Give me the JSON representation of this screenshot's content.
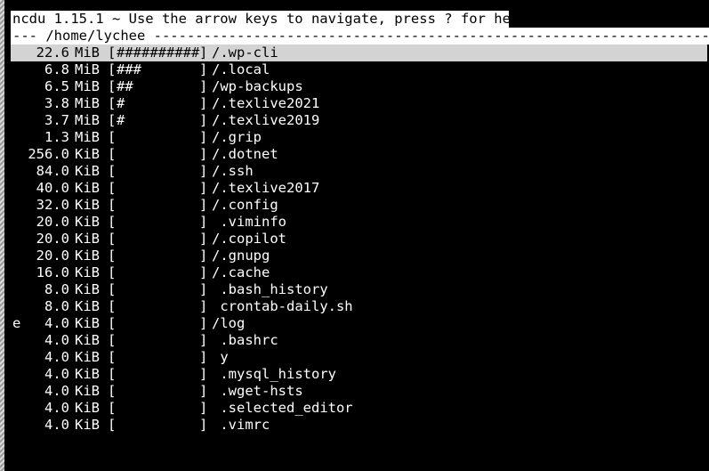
{
  "header": {
    "title_prefix": "ncdu 1.15.1 ~ Use the arrow keys to navigate, press ",
    "help_key": "?",
    "title_suffix": " for help"
  },
  "path_bar": {
    "text": "--- /home/lychee -------------------------------------------------------------------------------"
  },
  "entries": [
    {
      "flag": "",
      "size": "22.6",
      "unit": "MiB",
      "bar_open": "[",
      "bar": "##########",
      "bar_close": "]",
      "name": "/.wp-cli",
      "selected": true
    },
    {
      "flag": "",
      "size": "6.8",
      "unit": "MiB",
      "bar_open": "[",
      "bar": "###",
      "bar_close": "]",
      "name": "/.local"
    },
    {
      "flag": "",
      "size": "6.5",
      "unit": "MiB",
      "bar_open": "[",
      "bar": "##",
      "bar_close": "]",
      "name": "/wp-backups"
    },
    {
      "flag": "",
      "size": "3.8",
      "unit": "MiB",
      "bar_open": "[",
      "bar": "#",
      "bar_close": "]",
      "name": "/.texlive2021"
    },
    {
      "flag": "",
      "size": "3.7",
      "unit": "MiB",
      "bar_open": "[",
      "bar": "#",
      "bar_close": "]",
      "name": "/.texlive2019"
    },
    {
      "flag": "",
      "size": "1.3",
      "unit": "MiB",
      "bar_open": "[",
      "bar": "",
      "bar_close": "]",
      "name": "/.grip"
    },
    {
      "flag": "",
      "size": "256.0",
      "unit": "KiB",
      "bar_open": "[",
      "bar": "",
      "bar_close": "]",
      "name": "/.dotnet"
    },
    {
      "flag": "",
      "size": "84.0",
      "unit": "KiB",
      "bar_open": "[",
      "bar": "",
      "bar_close": "]",
      "name": "/.ssh"
    },
    {
      "flag": "",
      "size": "40.0",
      "unit": "KiB",
      "bar_open": "[",
      "bar": "",
      "bar_close": "]",
      "name": "/.texlive2017"
    },
    {
      "flag": "",
      "size": "32.0",
      "unit": "KiB",
      "bar_open": "[",
      "bar": "",
      "bar_close": "]",
      "name": "/.config"
    },
    {
      "flag": "",
      "size": "20.0",
      "unit": "KiB",
      "bar_open": "[",
      "bar": "",
      "bar_close": "]",
      "name": " .viminfo"
    },
    {
      "flag": "",
      "size": "20.0",
      "unit": "KiB",
      "bar_open": "[",
      "bar": "",
      "bar_close": "]",
      "name": "/.copilot"
    },
    {
      "flag": "",
      "size": "20.0",
      "unit": "KiB",
      "bar_open": "[",
      "bar": "",
      "bar_close": "]",
      "name": "/.gnupg"
    },
    {
      "flag": "",
      "size": "16.0",
      "unit": "KiB",
      "bar_open": "[",
      "bar": "",
      "bar_close": "]",
      "name": "/.cache"
    },
    {
      "flag": "",
      "size": "8.0",
      "unit": "KiB",
      "bar_open": "[",
      "bar": "",
      "bar_close": "]",
      "name": " .bash_history"
    },
    {
      "flag": "",
      "size": "8.0",
      "unit": "KiB",
      "bar_open": "[",
      "bar": "",
      "bar_close": "]",
      "name": " crontab-daily.sh"
    },
    {
      "flag": "e",
      "size": "4.0",
      "unit": "KiB",
      "bar_open": "[",
      "bar": "",
      "bar_close": "]",
      "name": "/log"
    },
    {
      "flag": "",
      "size": "4.0",
      "unit": "KiB",
      "bar_open": "[",
      "bar": "",
      "bar_close": "]",
      "name": " .bashrc"
    },
    {
      "flag": "",
      "size": "4.0",
      "unit": "KiB",
      "bar_open": "[",
      "bar": "",
      "bar_close": "]",
      "name": " y"
    },
    {
      "flag": "",
      "size": "4.0",
      "unit": "KiB",
      "bar_open": "[",
      "bar": "",
      "bar_close": "]",
      "name": " .mysql_history"
    },
    {
      "flag": "",
      "size": "4.0",
      "unit": "KiB",
      "bar_open": "[",
      "bar": "",
      "bar_close": "]",
      "name": " .wget-hsts"
    },
    {
      "flag": "",
      "size": "4.0",
      "unit": "KiB",
      "bar_open": "[",
      "bar": "",
      "bar_close": "]",
      "name": " .selected_editor"
    },
    {
      "flag": "",
      "size": "4.0",
      "unit": "KiB",
      "bar_open": "[",
      "bar": "",
      "bar_close": "]",
      "name": " .vimrc"
    }
  ],
  "colors": {
    "background": "#000000",
    "foreground": "#ffffff",
    "selection": "#d3d3d3"
  }
}
